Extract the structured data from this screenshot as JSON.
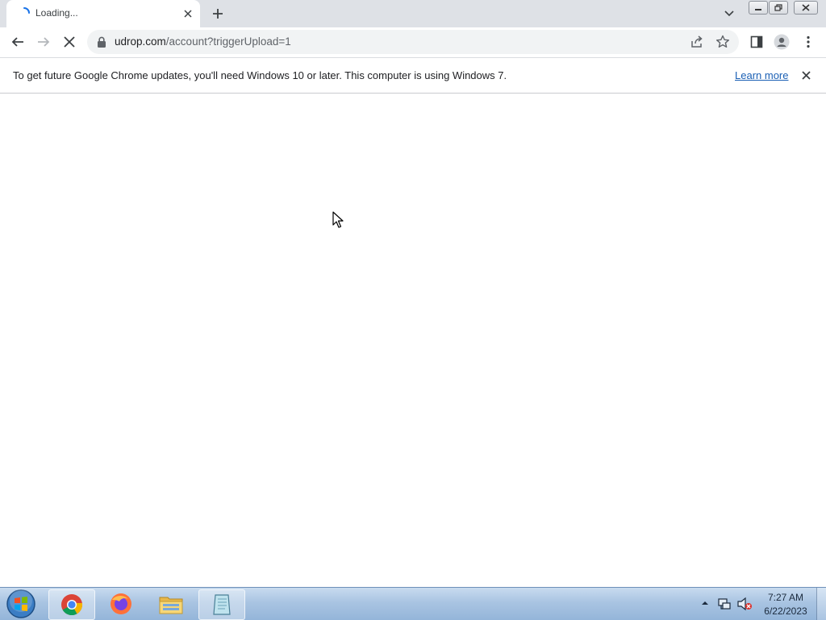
{
  "browser": {
    "tab": {
      "title": "Loading..."
    },
    "address_bar": {
      "host": "udrop.com",
      "path": "/account?triggerUpload=1"
    }
  },
  "infobar": {
    "message": "To get future Google Chrome updates, you'll need Windows 10 or later. This computer is using Windows 7.",
    "link_label": "Learn more"
  },
  "taskbar": {
    "apps": [
      "chrome-icon",
      "firefox-icon",
      "folder-icon",
      "notepad-icon"
    ],
    "clock": {
      "time": "7:27 AM",
      "date": "6/22/2023"
    }
  },
  "colors": {
    "tabstrip": "#dee1e6",
    "omnibox": "#f1f3f4",
    "link": "#1a5fb4",
    "spinner": "#1a73e8"
  }
}
